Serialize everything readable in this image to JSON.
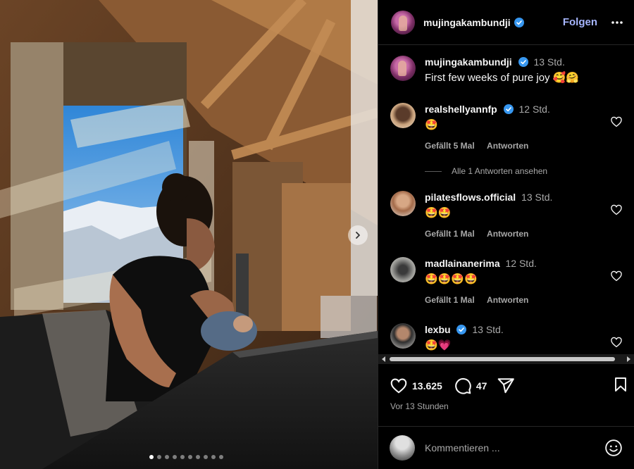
{
  "post": {
    "author": "mujingakambundji",
    "follow_label": "Folgen",
    "caption": {
      "username": "mujingakambundji",
      "time": "13 Std.",
      "text": "First few weeks of pure joy 🥰🤗"
    },
    "like_count": "13.625",
    "comment_count": "47",
    "timestamp": "Vor 13 Stunden",
    "carousel": {
      "slides": 10,
      "active": 1
    }
  },
  "comments": [
    {
      "username": "realshellyannfp",
      "verified": true,
      "time": "12 Std.",
      "text": "🤩",
      "likes": "Gefällt 5 Mal",
      "reply": "Antworten",
      "view_replies": "Alle 1 Antworten ansehen"
    },
    {
      "username": "pilatesflows.official",
      "verified": false,
      "time": "13 Std.",
      "text": "🤩🤩",
      "likes": "Gefällt 1 Mal",
      "reply": "Antworten"
    },
    {
      "username": "madlainanerima",
      "verified": false,
      "time": "12 Std.",
      "text": "🤩🤩🤩🤩",
      "likes": "Gefällt 1 Mal",
      "reply": "Antworten"
    },
    {
      "username": "lexbu",
      "verified": true,
      "time": "13 Std.",
      "text": "🤩💗"
    }
  ],
  "composer": {
    "placeholder": "Kommentieren ..."
  },
  "colors": {
    "accent": "#a7b6ff",
    "verified": "#3797f0",
    "bg": "#000000",
    "muted": "#a8a8a8"
  },
  "icons": [
    "verified-icon",
    "more-icon",
    "heart-icon",
    "comment-icon",
    "share-icon",
    "bookmark-icon",
    "emoji-icon",
    "chevron-right-icon"
  ]
}
